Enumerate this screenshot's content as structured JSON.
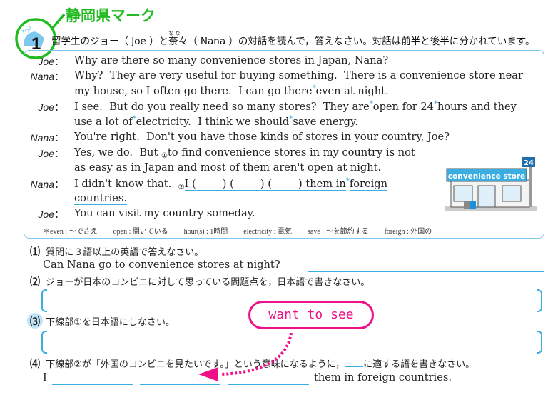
{
  "annotation": {
    "mark_title": "静岡県マーク",
    "mark_color": "#22bb22",
    "hint": "want to see",
    "hint_color": "#ee1188"
  },
  "problem": {
    "number": "1",
    "badge": "Try!",
    "instruction_pre": "留学生のジョー（ Joe ）と",
    "nana_kanji": "奈々",
    "nana_ruby": "な な",
    "instruction_post": "（ Nana ）の対話を読んで，答えなさい。対話は前半と後半に分かれています。"
  },
  "dialogue": [
    {
      "speaker": "Joe",
      "parts": [
        {
          "t": "Why are there so many convenience stores in Japan, Nana?"
        }
      ]
    },
    {
      "speaker": "Nana",
      "parts": [
        {
          "t": "Why?  They are very useful for buying something.  There is a convenience store near"
        }
      ]
    },
    {
      "speaker": "",
      "parts": [
        {
          "t": "my house, so I often go there.  I can go there"
        },
        {
          "star": "*"
        },
        {
          "t": "even at night."
        }
      ]
    },
    {
      "speaker": "Joe",
      "parts": [
        {
          "t": "I see.  But do you really need so many stores?  They are"
        },
        {
          "star": "*"
        },
        {
          "t": "open for 24"
        },
        {
          "star": "*"
        },
        {
          "t": "hours and they"
        }
      ]
    },
    {
      "speaker": "",
      "parts": [
        {
          "t": "use a lot of"
        },
        {
          "star": "*"
        },
        {
          "t": "electricity.  I think we should"
        },
        {
          "star": "*"
        },
        {
          "t": "save energy."
        }
      ]
    },
    {
      "speaker": "Nana",
      "parts": [
        {
          "t": "You're right.  Don't you have those kinds of stores in your country, Joe?"
        }
      ]
    },
    {
      "speaker": "Joe",
      "parts": [
        {
          "t": "Yes, we do.  But "
        },
        {
          "circ": "①"
        },
        {
          "t": "to find convenience stores in my country is not",
          "ul": true
        }
      ]
    },
    {
      "speaker": "",
      "parts": [
        {
          "t": "as easy as in Japan",
          "ul": true
        },
        {
          "t": " and most of them aren't open at night."
        }
      ]
    },
    {
      "speaker": "Nana",
      "parts": [
        {
          "t": "I didn't know that.  "
        },
        {
          "circ": "②"
        },
        {
          "t": "I (        ) (        ) (        ) them in",
          "ul": true
        },
        {
          "star": "*"
        },
        {
          "t": "foreign",
          "ul": true
        }
      ]
    },
    {
      "speaker": "",
      "parts": [
        {
          "t": "countries.",
          "ul": true
        }
      ]
    },
    {
      "speaker": "Joe",
      "parts": [
        {
          "t": "You can visit my country someday."
        }
      ]
    }
  ],
  "glossary": [
    "＊even : ～でさえ",
    "open : 開いている",
    "hour(s) : 1時間",
    "electricity : 電気",
    "save : ～を節約する",
    "foreign : 外国の"
  ],
  "store_image": {
    "sign": "convenience store",
    "pole_sign": "24"
  },
  "questions": [
    {
      "num": "⑴",
      "text": "質問に３語以上の英語で答えなさい。",
      "sub": "Can Nana go to convenience stores at night?"
    },
    {
      "num": "⑵",
      "text": "ジョーが日本のコンビニに対して思っている問題点を，日本語で書きなさい。"
    },
    {
      "num": "⑶",
      "text": "下線部①を日本語にしなさい。"
    },
    {
      "num": "⑷",
      "text_pre": "下線部②が「外国のコンビニを見たいです。」という意味になるように，",
      "text_post": "に適する語を書きなさい。",
      "sub_pre": "I",
      "sub_post": "them in foreign countries."
    }
  ],
  "colors": {
    "accent": "#3aaee0"
  }
}
